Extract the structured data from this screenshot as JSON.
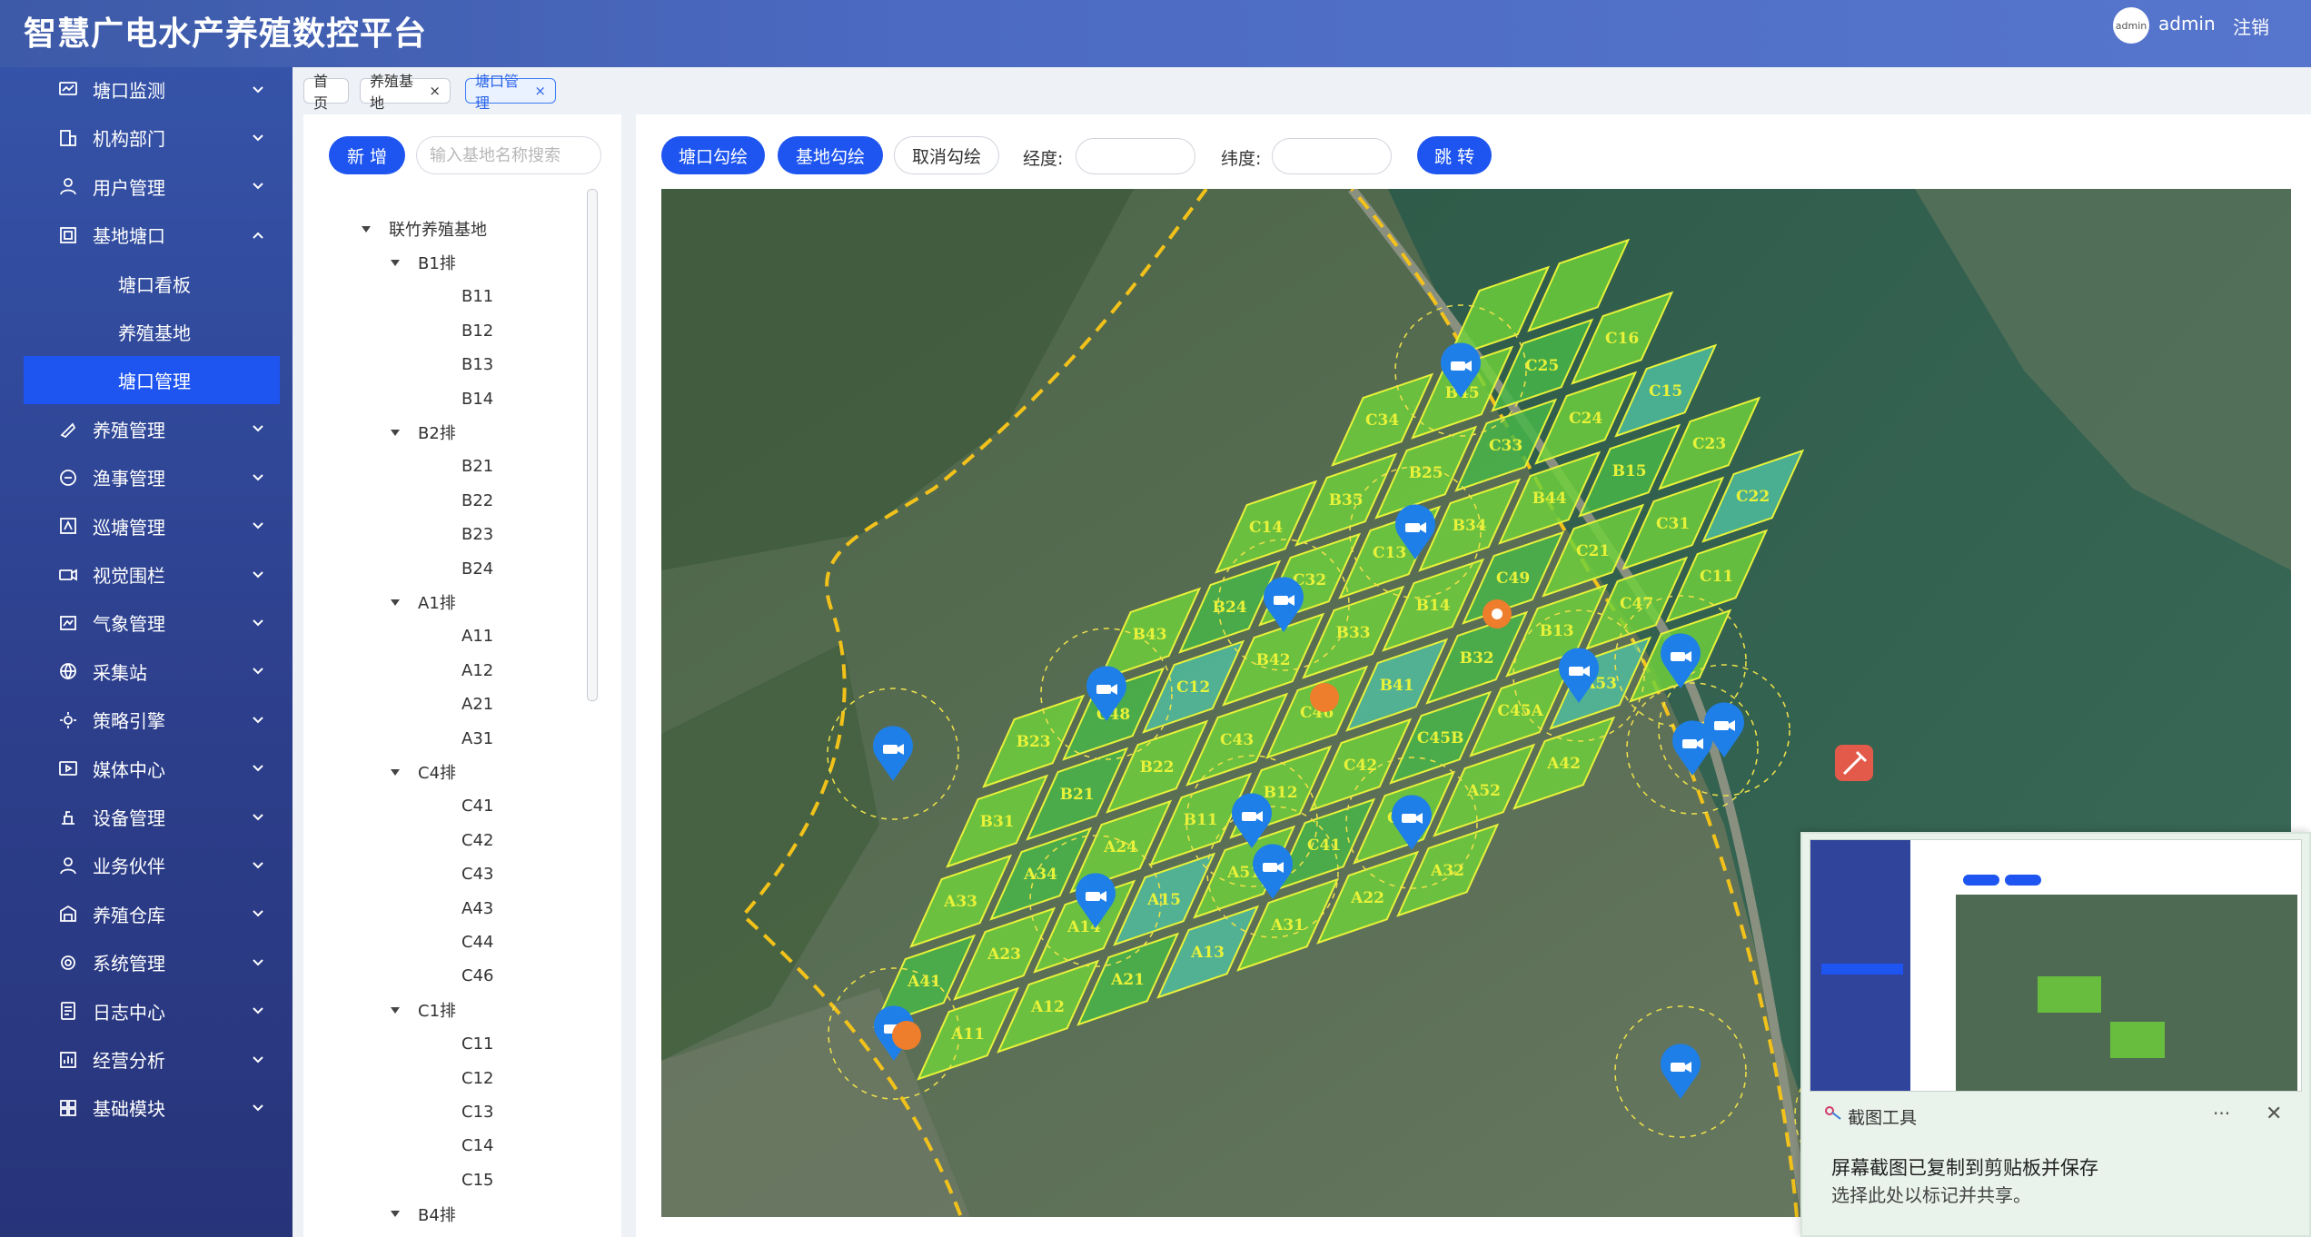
{
  "header": {
    "title": "智慧广电水产养殖数控平台",
    "avatar_text": "admin",
    "username": "admin",
    "logout": "注销"
  },
  "sidebar": {
    "items": [
      {
        "label": "塘口监测",
        "icon": "monitor-icon"
      },
      {
        "label": "机构部门",
        "icon": "building-icon"
      },
      {
        "label": "用户管理",
        "icon": "user-icon"
      },
      {
        "label": "基地塘口",
        "icon": "base-icon",
        "expanded": true
      },
      {
        "label": "养殖管理",
        "icon": "feed-icon"
      },
      {
        "label": "渔事管理",
        "icon": "fishery-icon"
      },
      {
        "label": "巡塘管理",
        "icon": "patrol-icon"
      },
      {
        "label": "视觉围栏",
        "icon": "camera-icon"
      },
      {
        "label": "气象管理",
        "icon": "weather-icon"
      },
      {
        "label": "采集站",
        "icon": "globe-icon"
      },
      {
        "label": "策略引擎",
        "icon": "sun-icon"
      },
      {
        "label": "媒体中心",
        "icon": "media-icon"
      },
      {
        "label": "设备管理",
        "icon": "device-icon"
      },
      {
        "label": "业务伙伴",
        "icon": "partner-icon"
      },
      {
        "label": "养殖仓库",
        "icon": "warehouse-icon"
      },
      {
        "label": "系统管理",
        "icon": "settings-icon"
      },
      {
        "label": "日志中心",
        "icon": "log-icon"
      },
      {
        "label": "经营分析",
        "icon": "analysis-icon"
      },
      {
        "label": "基础模块",
        "icon": "grid-icon"
      }
    ],
    "subitems": [
      "塘口看板",
      "养殖基地",
      "塘口管理"
    ],
    "active_subitem": "塘口管理"
  },
  "tabs": [
    {
      "label": "首页",
      "closable": false,
      "active": false
    },
    {
      "label": "养殖基地",
      "closable": true,
      "active": false
    },
    {
      "label": "塘口管理",
      "closable": true,
      "active": true
    }
  ],
  "tree_panel": {
    "add_button": "新 增",
    "search_placeholder": "输入基地名称搜索",
    "root": "联竹养殖基地",
    "groups": [
      {
        "name": "B1排",
        "children": [
          "B11",
          "B12",
          "B13",
          "B14"
        ]
      },
      {
        "name": "B2排",
        "children": [
          "B21",
          "B22",
          "B23",
          "B24"
        ]
      },
      {
        "name": "A1排",
        "children": [
          "A11",
          "A12",
          "A21",
          "A31"
        ]
      },
      {
        "name": "C4排",
        "children": [
          "C41",
          "C42",
          "C43",
          "A43",
          "C44",
          "C46"
        ]
      },
      {
        "name": "C1排",
        "children": [
          "C11",
          "C12",
          "C13",
          "C14",
          "C15"
        ]
      },
      {
        "name": "B4排",
        "children": []
      }
    ]
  },
  "toolbar": {
    "pond_draw": "塘口勾绘",
    "base_draw": "基地勾绘",
    "cancel_draw": "取消勾绘",
    "longitude_label": "经度:",
    "latitude_label": "纬度:",
    "jump": "跳 转",
    "longitude_value": "",
    "latitude_value": ""
  },
  "map": {
    "pond_labels": [
      "A11",
      "A12",
      "A21",
      "A13",
      "A31",
      "A22",
      "A32",
      "A41",
      "A23",
      "A14",
      "A15",
      "A51",
      "C41",
      "C44",
      "A52",
      "A42",
      "A33",
      "A34",
      "A24",
      "B11",
      "B12",
      "C42",
      "C45B",
      "C45A",
      "A53",
      "A43",
      "B31",
      "B21",
      "B22",
      "C43",
      "C46",
      "B41",
      "B32",
      "B13",
      "C47",
      "C11",
      "B23",
      "C48",
      "C12",
      "B42",
      "B33",
      "B14",
      "C49",
      "C21",
      "C31",
      "C22",
      "B43",
      "B24",
      "C32",
      "C13",
      "B34",
      "B44",
      "B15",
      "C23",
      "C14",
      "B35",
      "B25",
      "C33",
      "C24",
      "C15",
      "C34",
      "B45",
      "C25",
      "C16"
    ],
    "colors": {
      "pond_fill": "#6fd23a",
      "pond_stroke": "#e8f23a",
      "boundary": "#f2c21a",
      "camera": "#1e7fe8",
      "alert": "#ee7d2c"
    }
  },
  "toast": {
    "app": "截图工具",
    "more": "···",
    "title": "屏幕截图已复制到剪贴板并保存",
    "body": "选择此处以标记并共享。"
  }
}
